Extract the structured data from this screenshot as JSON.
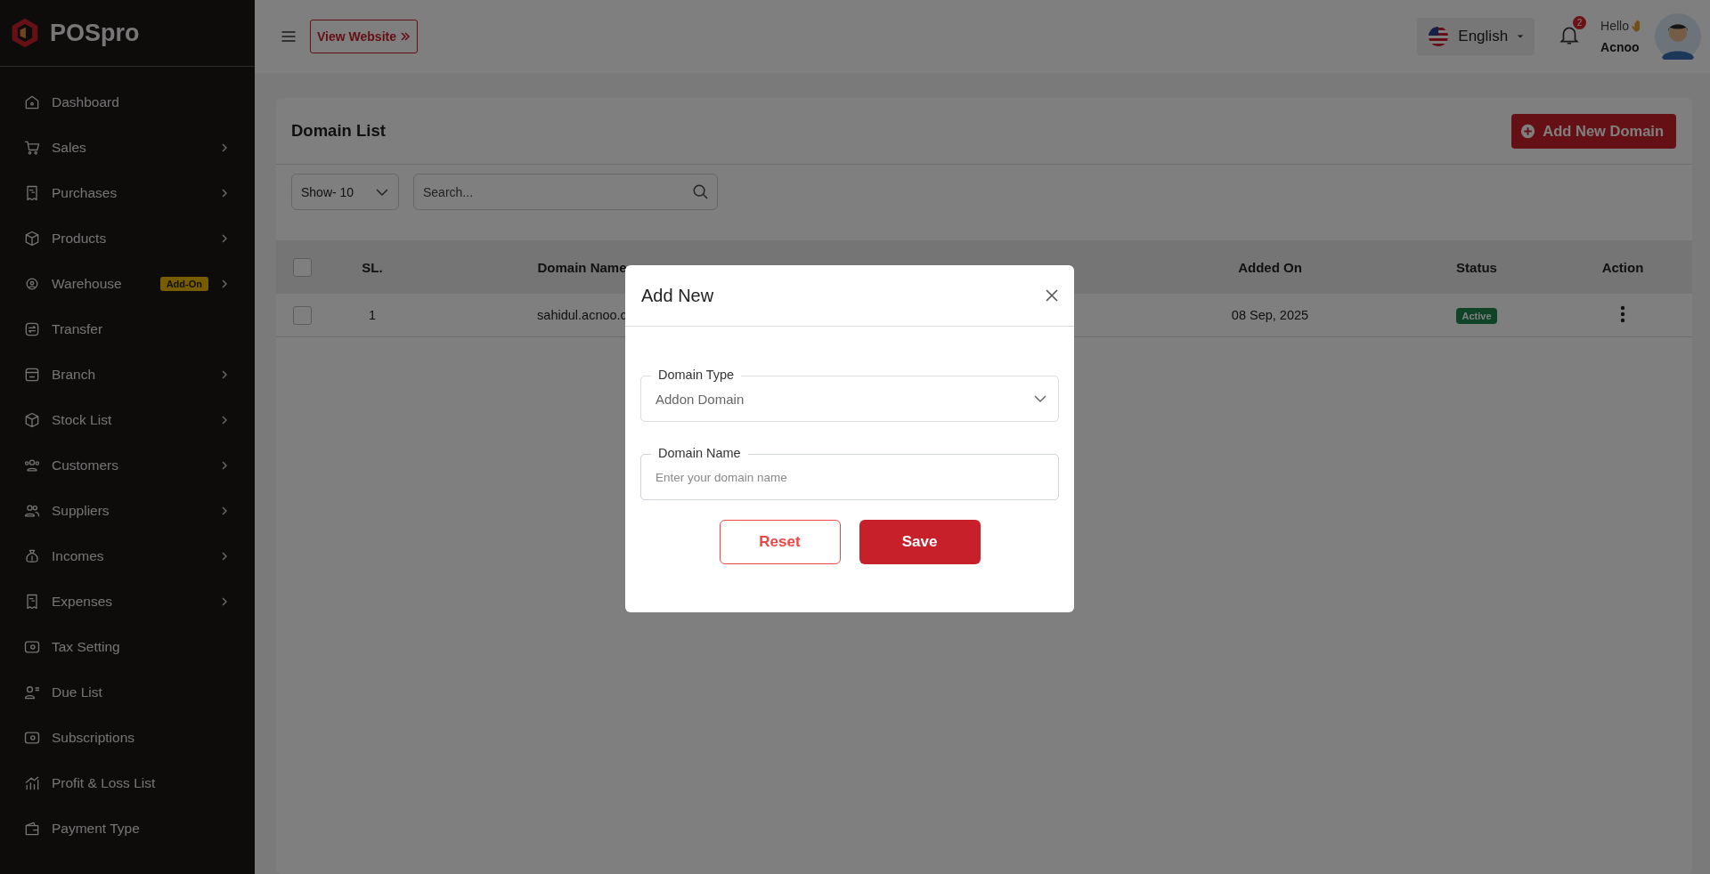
{
  "sidebar": {
    "logo": "POSpro",
    "items": [
      {
        "label": "Dashboard",
        "expandable": false
      },
      {
        "label": "Sales",
        "expandable": true
      },
      {
        "label": "Purchases",
        "expandable": true
      },
      {
        "label": "Products",
        "expandable": true
      },
      {
        "label": "Warehouse",
        "expandable": true,
        "badge": "Add-On"
      },
      {
        "label": "Transfer",
        "expandable": false
      },
      {
        "label": "Branch",
        "expandable": true
      },
      {
        "label": "Stock List",
        "expandable": true
      },
      {
        "label": "Customers",
        "expandable": true
      },
      {
        "label": "Suppliers",
        "expandable": true
      },
      {
        "label": "Incomes",
        "expandable": true
      },
      {
        "label": "Expenses",
        "expandable": true
      },
      {
        "label": "Tax Setting",
        "expandable": false
      },
      {
        "label": "Due List",
        "expandable": false
      },
      {
        "label": "Subscriptions",
        "expandable": false
      },
      {
        "label": "Profit & Loss List",
        "expandable": false
      },
      {
        "label": "Payment Type",
        "expandable": false
      }
    ]
  },
  "header": {
    "view_website": "View Website",
    "language": "English",
    "notifications": "2",
    "greeting": "Hello",
    "user": "Acnoo"
  },
  "page": {
    "title": "Domain List",
    "add_button": "Add New Domain",
    "show_select": "Show- 10",
    "search": {
      "placeholder": "Search..."
    },
    "table": {
      "select_all": {
        "checked": false
      },
      "columns": [
        "SL.",
        "Domain Name",
        "Added On",
        "Status",
        "Action"
      ],
      "rows": [
        {
          "checked": false,
          "sl": "1",
          "domain": "sahidul.acnoo.c",
          "added_on": "08 Sep, 2025",
          "status": "Active"
        }
      ]
    }
  },
  "modal": {
    "title": "Add New",
    "fields": [
      {
        "kind": "select",
        "label": "Domain Type",
        "value": "Addon Domain"
      },
      {
        "kind": "input",
        "label": "Domain Name",
        "placeholder": "Enter your domain name"
      }
    ],
    "buttons": [
      {
        "kind": "outline",
        "label": "Reset"
      },
      {
        "kind": "primary",
        "label": "Save"
      }
    ]
  }
}
